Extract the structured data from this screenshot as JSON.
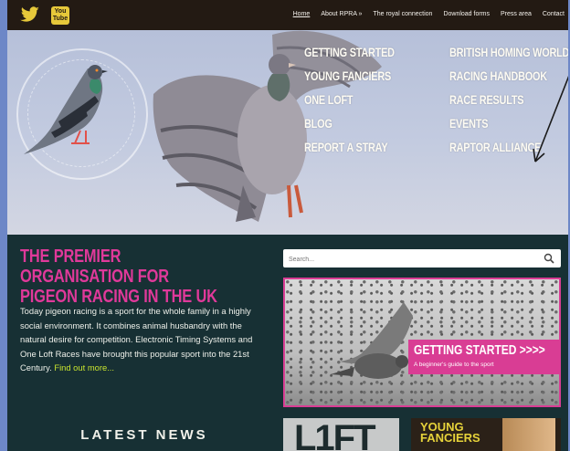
{
  "social": {
    "twitter_icon": "twitter-bird-icon",
    "youtube_label": "You Tube"
  },
  "nav": {
    "items": [
      "Home",
      "About RPRA »",
      "The royal connection",
      "Download forms",
      "Press area",
      "Contact"
    ]
  },
  "hero": {
    "menu_left": [
      "GETTING STARTED",
      "YOUNG FANCIERS",
      "ONE LOFT",
      "BLOG",
      "REPORT A STRAY"
    ],
    "menu_right": [
      "BRITISH HOMING WORLD",
      "RACING HANDBOOK",
      "RACE RESULTS",
      "EVENTS",
      "RAPTOR ALLIANCE"
    ]
  },
  "main": {
    "headline": "THE PREMIER ORGANISATION FOR PIGEON RACING IN THE UK",
    "intro": "Today pigeon racing is a sport for the whole family in a highly social environment. It combines animal husbandry with the natural desire for competition. Electronic Timing Systems and One Loft Races have brought this popular sport into the 21st Century.",
    "find_out_more": "Find out more...",
    "latest_news": "LATEST NEWS"
  },
  "search": {
    "placeholder": "Search..."
  },
  "getting_started": {
    "title": "GETTING STARTED >>>>",
    "subtitle": "A beginner's guide to the sport"
  },
  "tiles": {
    "loft": "L1FT",
    "young_fanciers": "YOUNG FANCIERS"
  },
  "colors": {
    "accent_pink": "#d93d94",
    "link_green": "#c9e52f",
    "background": "#173034",
    "topbar": "#231a13"
  }
}
